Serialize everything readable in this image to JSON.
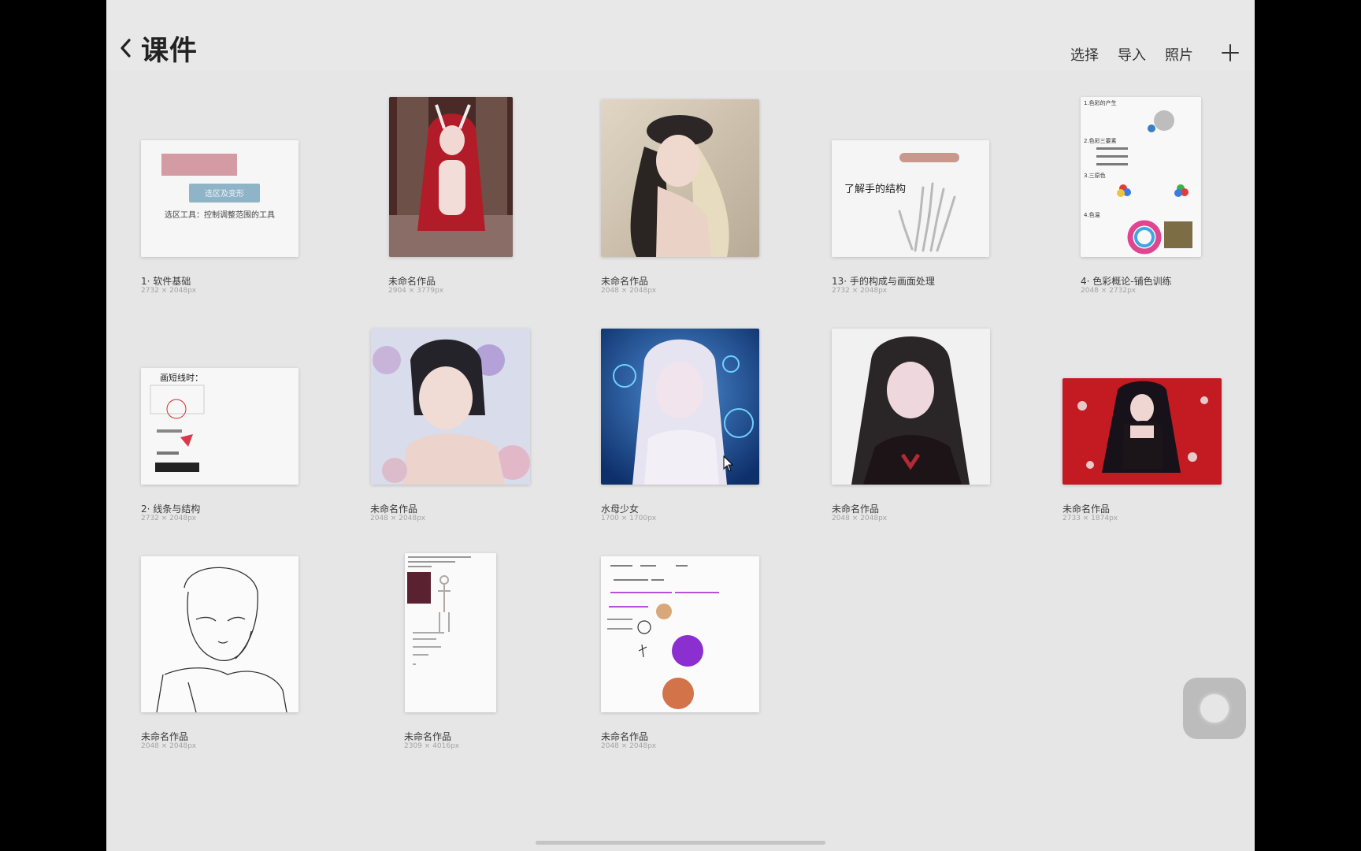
{
  "header": {
    "title": "课件",
    "actions": [
      "选择",
      "导入",
      "照片"
    ],
    "add_icon": "plus-icon"
  },
  "gallery": [
    {
      "name": "1· 软件基础",
      "dims": "2732 × 2048px",
      "preview_texts": [
        "选区及变形",
        "选区工具：控制调整范围的工具"
      ]
    },
    {
      "name": "未命名作品",
      "dims": "2904 × 3779px"
    },
    {
      "name": "未命名作品",
      "dims": "2048 × 2048px"
    },
    {
      "name": "13· 手的构成与画面处理",
      "dims": "2732 × 2048px",
      "preview_texts": [
        "了解手的结构"
      ]
    },
    {
      "name": "4· 色彩概论-铺色训练",
      "dims": "2048 × 2732px",
      "preview_texts": [
        "1.色彩的产生",
        "2.色彩三要素",
        "3.三原色",
        "4.色温"
      ]
    },
    {
      "name": "2· 线条与结构",
      "dims": "2732 × 2048px",
      "preview_texts": [
        "画短线时："
      ]
    },
    {
      "name": "未命名作品",
      "dims": "2048 × 2048px"
    },
    {
      "name": "水母少女",
      "dims": "1700 × 1700px"
    },
    {
      "name": "未命名作品",
      "dims": "2048 × 2048px"
    },
    {
      "name": "未命名作品",
      "dims": "2733 × 1874px"
    },
    {
      "name": "未命名作品",
      "dims": "2048 × 2048px"
    },
    {
      "name": "未命名作品",
      "dims": "2309 × 4016px"
    },
    {
      "name": "未命名作品",
      "dims": "2048 × 2048px"
    }
  ],
  "colors": {
    "background": "#e6e6e7",
    "text": "#222222",
    "secondary_text": "#a3a3a3"
  }
}
